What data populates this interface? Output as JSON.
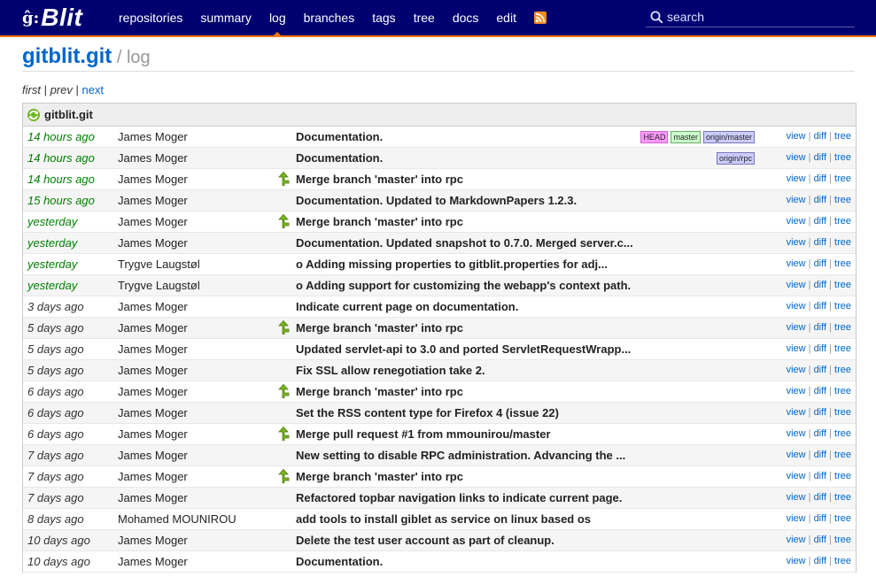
{
  "brand": {
    "mark": "ĝ:",
    "name": "Blit"
  },
  "nav": [
    "repositories",
    "summary",
    "log",
    "branches",
    "tags",
    "tree",
    "docs",
    "edit"
  ],
  "nav_active": "log",
  "search": {
    "placeholder": "search"
  },
  "title": {
    "repo": "gitblit.git",
    "sep": " / ",
    "page": "log"
  },
  "pager": {
    "first": "first",
    "sep1": " | ",
    "prev": "prev",
    "sep2": " | ",
    "next": "next"
  },
  "log": {
    "header": "gitblit.git",
    "links": {
      "view": "view",
      "diff": "diff",
      "tree": "tree",
      "sep": " | "
    },
    "rows": [
      {
        "age": "14 hours ago",
        "recent": true,
        "author": "James Moger",
        "merge": false,
        "message": "Documentation.",
        "refs": [
          {
            "label": "HEAD",
            "kind": "head"
          },
          {
            "label": "master",
            "kind": "local"
          },
          {
            "label": "origin/master",
            "kind": "remote"
          }
        ]
      },
      {
        "age": "14 hours ago",
        "recent": true,
        "author": "James Moger",
        "merge": false,
        "message": "Documentation.",
        "refs": [
          {
            "label": "origin/rpc",
            "kind": "remote"
          }
        ]
      },
      {
        "age": "14 hours ago",
        "recent": true,
        "author": "James Moger",
        "merge": true,
        "message": "Merge branch 'master' into rpc",
        "refs": []
      },
      {
        "age": "15 hours ago",
        "recent": true,
        "author": "James Moger",
        "merge": false,
        "message": "Documentation. Updated to MarkdownPapers 1.2.3.",
        "refs": []
      },
      {
        "age": "yesterday",
        "recent": true,
        "author": "James Moger",
        "merge": true,
        "message": "Merge branch 'master' into rpc",
        "refs": []
      },
      {
        "age": "yesterday",
        "recent": true,
        "author": "James Moger",
        "merge": false,
        "message": "Documentation. Updated snapshot to 0.7.0. Merged server.c...",
        "refs": []
      },
      {
        "age": "yesterday",
        "recent": true,
        "author": "Trygve Laugstøl",
        "merge": false,
        "message": "o Adding missing properties to gitblit.properties for adj...",
        "refs": []
      },
      {
        "age": "yesterday",
        "recent": true,
        "author": "Trygve Laugstøl",
        "merge": false,
        "message": "o Adding support for customizing the webapp's context path.",
        "refs": []
      },
      {
        "age": "3 days ago",
        "recent": false,
        "author": "James Moger",
        "merge": false,
        "message": "Indicate current page on documentation.",
        "refs": []
      },
      {
        "age": "5 days ago",
        "recent": false,
        "author": "James Moger",
        "merge": true,
        "message": "Merge branch 'master' into rpc",
        "refs": []
      },
      {
        "age": "5 days ago",
        "recent": false,
        "author": "James Moger",
        "merge": false,
        "message": "Updated servlet-api to 3.0 and ported ServletRequestWrapp...",
        "refs": []
      },
      {
        "age": "5 days ago",
        "recent": false,
        "author": "James Moger",
        "merge": false,
        "message": "Fix SSL allow renegotiation take 2.",
        "refs": []
      },
      {
        "age": "6 days ago",
        "recent": false,
        "author": "James Moger",
        "merge": true,
        "message": "Merge branch 'master' into rpc",
        "refs": []
      },
      {
        "age": "6 days ago",
        "recent": false,
        "author": "James Moger",
        "merge": false,
        "message": "Set the RSS content type for Firefox 4 (issue 22)",
        "refs": []
      },
      {
        "age": "6 days ago",
        "recent": false,
        "author": "James Moger",
        "merge": true,
        "message": "Merge pull request #1 from mmounirou/master",
        "refs": []
      },
      {
        "age": "7 days ago",
        "recent": false,
        "author": "James Moger",
        "merge": false,
        "message": "New setting to disable RPC administration. Advancing the ...",
        "refs": []
      },
      {
        "age": "7 days ago",
        "recent": false,
        "author": "James Moger",
        "merge": true,
        "message": "Merge branch 'master' into rpc",
        "refs": []
      },
      {
        "age": "7 days ago",
        "recent": false,
        "author": "James Moger",
        "merge": false,
        "message": "Refactored topbar navigation links to indicate current page.",
        "refs": []
      },
      {
        "age": "8 days ago",
        "recent": false,
        "author": "Mohamed MOUNIROU",
        "merge": false,
        "message": "add tools to install giblet as service on linux based os",
        "refs": []
      },
      {
        "age": "10 days ago",
        "recent": false,
        "author": "James Moger",
        "merge": false,
        "message": "Delete the test user account as part of cleanup.",
        "refs": []
      },
      {
        "age": "10 days ago",
        "recent": false,
        "author": "James Moger",
        "merge": false,
        "message": "Documentation.",
        "refs": []
      }
    ]
  }
}
